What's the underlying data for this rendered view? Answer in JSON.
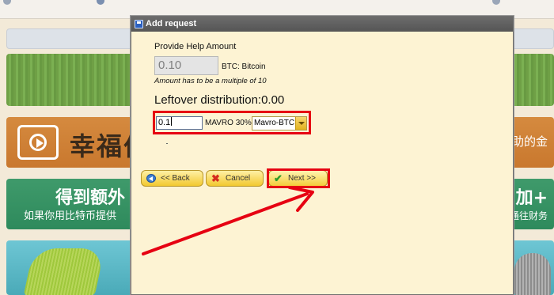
{
  "background": {
    "orange_banner_text": "幸福伯",
    "orange_banner_right": "帮助的金",
    "teal_banner_line1": "得到额外",
    "teal_banner_line2": "如果你用比特币提供",
    "teal_banner_right1": "加+",
    "teal_banner_right2": "通往财务"
  },
  "dialog": {
    "title": "Add request",
    "provide_help_label": "Provide Help Amount",
    "amount_value": "0.10",
    "currency_label": "BTC: Bitcoin",
    "amount_hint": "Amount has to be a multiple of 10",
    "leftover_text": "Leftover distribution:0.00",
    "mavro_value": "0.1",
    "mavro_label": "MAVRO 30%",
    "mavro_select_value": "Mavro-BTC",
    "back_label": "<< Back",
    "cancel_label": "Cancel",
    "next_label": "Next >>"
  },
  "colors": {
    "annotation_red": "#e60012",
    "dialog_bg": "#fdf3d3",
    "button_gold": "#f2c930"
  },
  "icons": [
    "back-arrow-icon",
    "cancel-x-icon",
    "next-check-icon",
    "disk-icon",
    "play-icon"
  ]
}
